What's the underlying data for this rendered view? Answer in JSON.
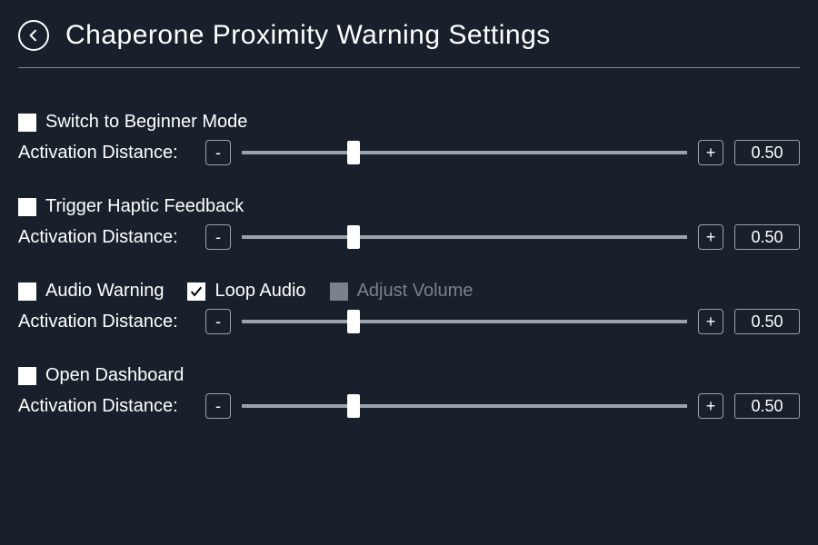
{
  "colors": {
    "background": "#18202b",
    "text": "#ffffff",
    "muted": "#7a828c",
    "border": "#9aa2ab"
  },
  "header": {
    "title": "Chaperone Proximity Warning Settings"
  },
  "labels": {
    "activation_distance": "Activation Distance:"
  },
  "sections": {
    "beginner": {
      "option_label": "Switch to Beginner Mode",
      "option_checked": false,
      "value": "0.50",
      "handle_percent": 25
    },
    "haptic": {
      "option_label": "Trigger Haptic Feedback",
      "option_checked": false,
      "value": "0.50",
      "handle_percent": 25
    },
    "audio": {
      "option_label": "Audio Warning",
      "option_checked": false,
      "loop_label": "Loop Audio",
      "loop_checked": true,
      "adjust_label": "Adjust Volume",
      "adjust_enabled": false,
      "adjust_checked": false,
      "value": "0.50",
      "handle_percent": 25
    },
    "dashboard": {
      "option_label": "Open Dashboard",
      "option_checked": false,
      "value": "0.50",
      "handle_percent": 25
    }
  },
  "buttons": {
    "minus": "-",
    "plus": "+"
  }
}
